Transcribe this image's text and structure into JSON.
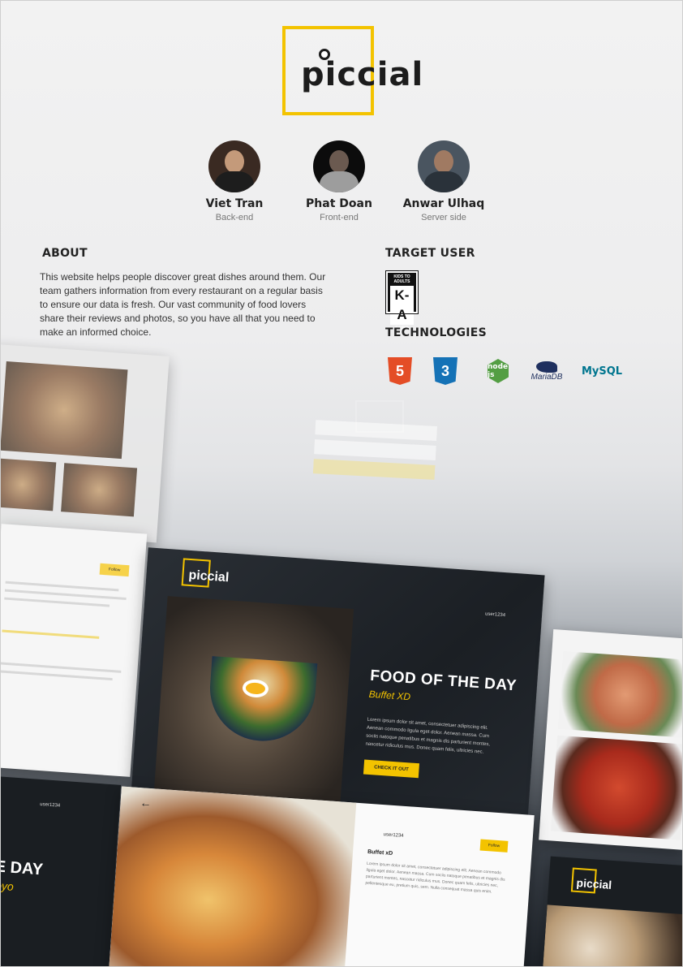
{
  "brand": {
    "name": "piccial",
    "accent": "#f3c300"
  },
  "team": [
    {
      "name": "Viet Tran",
      "role": "Back-end"
    },
    {
      "name": "Phat Doan",
      "role": "Front-end"
    },
    {
      "name": "Anwar Ulhaq",
      "role": "Server side"
    }
  ],
  "about": {
    "heading": "ABOUT",
    "text": "This website helps people discover great dishes around them. Our team gathers information from every restaurant on a regular basis to ensure our data is fresh. Our vast community of food lovers share their reviews and photos, so you have all that you need to make an informed choice."
  },
  "target_user": {
    "heading": "TARGET USER",
    "badge_top": "KIDS TO ADULTS",
    "badge_mark": "K-A",
    "badge_bottom": "ESRB"
  },
  "technologies": {
    "heading": "TECHNOLOGIES",
    "items": [
      {
        "label": "5",
        "icon": "html5-icon",
        "color": "#e44d26"
      },
      {
        "label": "3",
        "icon": "css3-icon",
        "color": "#1572b6"
      },
      {
        "label": "node js",
        "icon": "nodejs-icon",
        "color": "#539e43"
      },
      {
        "label": "MariaDB",
        "icon": "mariadb-icon",
        "color": "#1f305f"
      },
      {
        "label": "MySQL",
        "icon": "mysql-icon",
        "color": "#00758f"
      }
    ]
  },
  "collage": {
    "hero": {
      "brand": "piccial",
      "title": "FOOD OF THE DAY",
      "subtitle": "Buffet XD",
      "body": "Lorem ipsum dolor sit amet, consectetuer adipiscing elit. Aenean commodo ligula eget dolor. Aenean massa. Cum sociis natoque penatibus et magnis dis parturient montes, nascetur ridiculus mus. Donec quam felis, ultricies nec.",
      "cta": "CHECK IT OUT",
      "user": "user1234"
    },
    "post": {
      "user": "user1234",
      "follow": "Follow",
      "title": "Buffet xD",
      "text": "Lorem ipsum dolor sit amet, consectetuer adipiscing elit. Aenean commodo ligula eget dolor. Aenean massa. Cum sociis natoque penatibus et magnis dis parturient montes, nascetur ridiculus mus. Donec quam felis, ultricies nec, pellentesque eu, pretium quis, sem. Nulla consequat massa quis enim.",
      "back": "←"
    },
    "left_card": {
      "follow": "Follow"
    },
    "bottom_left": {
      "title": "E DAY",
      "subtitle": "oyo",
      "user": "user1234"
    },
    "bottom_right": {
      "brand": "piccial"
    }
  }
}
